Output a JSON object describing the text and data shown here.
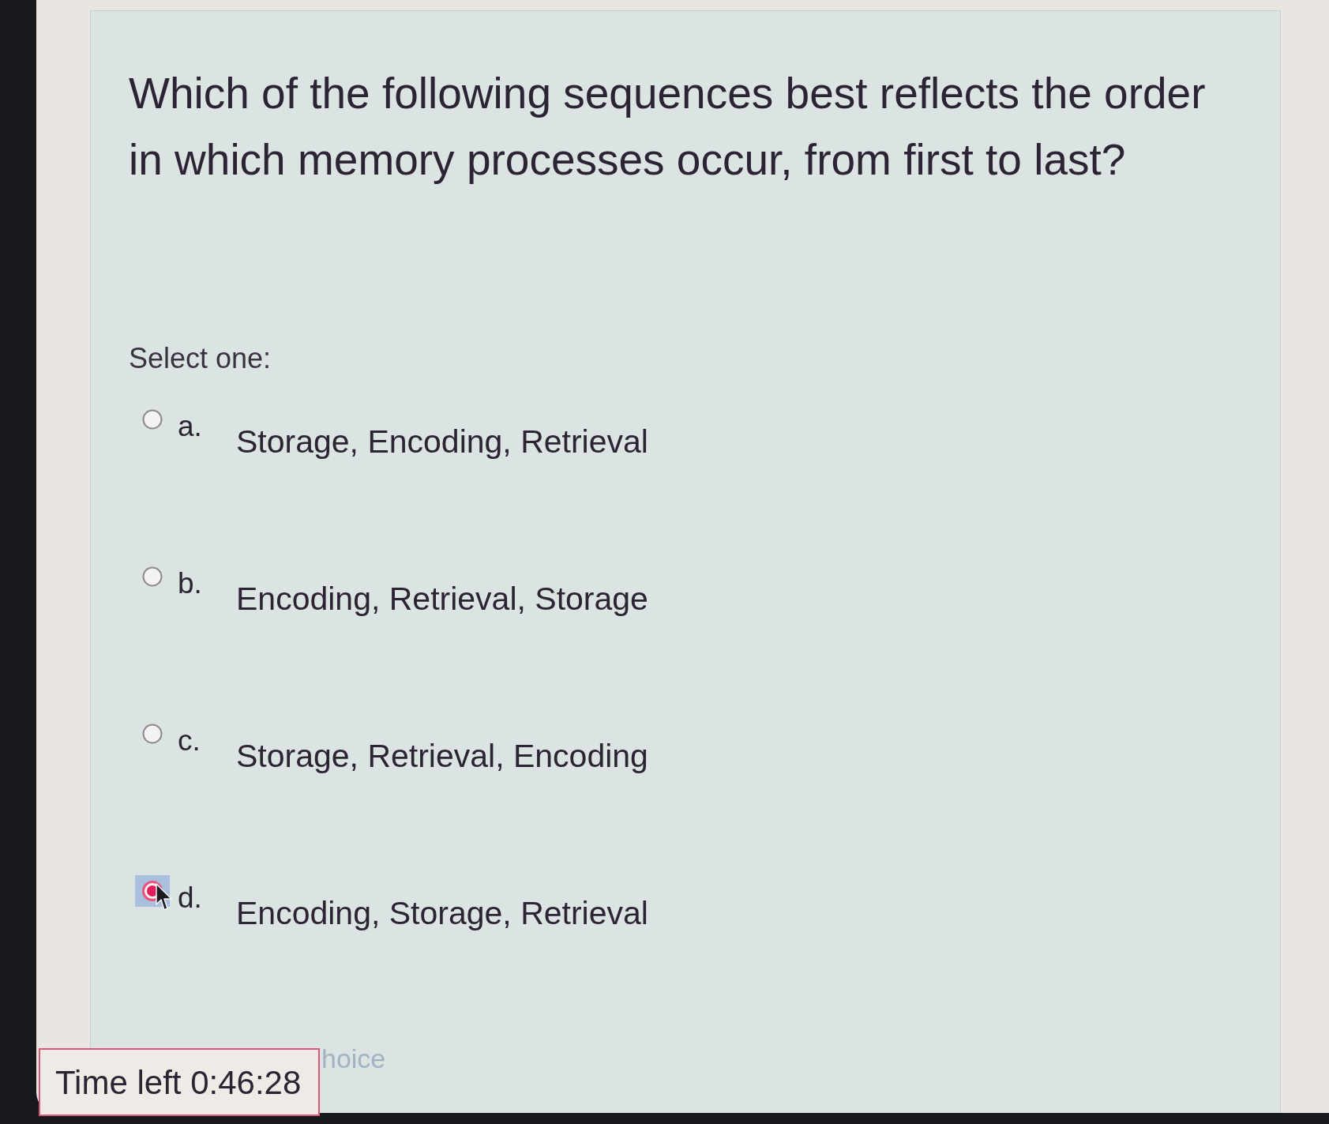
{
  "question": {
    "text": "Which of the following sequences best reflects the order in which memory processes occur, from first to last?"
  },
  "prompt": "Select one:",
  "options": [
    {
      "letter": "a.",
      "text": "Storage, Encoding, Retrieval",
      "selected": false,
      "focused": false
    },
    {
      "letter": "b.",
      "text": "Encoding, Retrieval, Storage",
      "selected": false,
      "focused": false
    },
    {
      "letter": "c.",
      "text": "Storage, Retrieval, Encoding",
      "selected": false,
      "focused": false
    },
    {
      "letter": "d.",
      "text": "Encoding, Storage, Retrieval",
      "selected": true,
      "focused": true
    }
  ],
  "clear_link": {
    "text": "hoice"
  },
  "timer": {
    "text": "Time left 0:46:28"
  }
}
